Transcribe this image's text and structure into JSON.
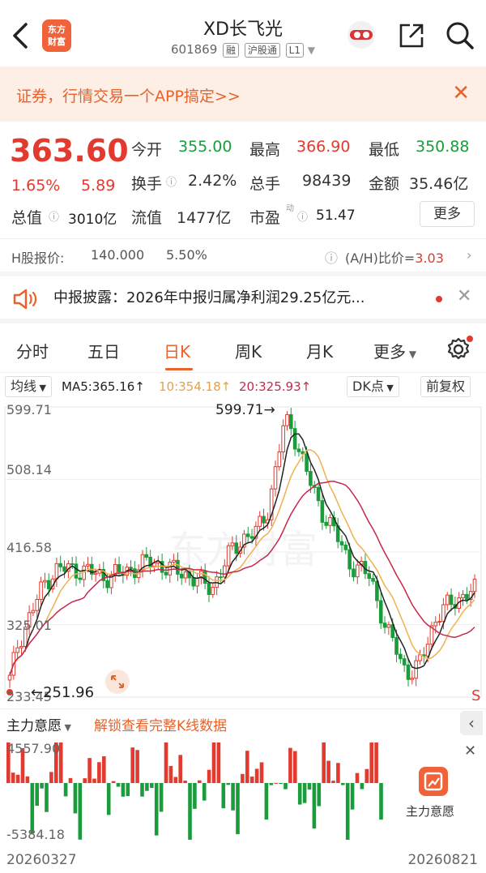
{
  "header": {
    "logo_text_line1": "东方",
    "logo_text_line2": "财富",
    "title": "XD长飞光",
    "code": "601869",
    "tags": [
      "融",
      "沪股通",
      "L1"
    ]
  },
  "banner": {
    "text": "证券，行情交易一个APP搞定>>"
  },
  "quote": {
    "price": "363.60",
    "change_pct": "1.65%",
    "change_amt": "5.89",
    "open_label": "今开",
    "open_value": "355.00",
    "high_label": "最高",
    "high_value": "366.90",
    "low_label": "最低",
    "low_value": "350.88",
    "turnover_label": "换手",
    "turnover_value": "2.42%",
    "volume_label": "总手",
    "volume_value": "98439",
    "amount_label": "金额",
    "amount_value": "35.46亿",
    "mktcap_label": "总值",
    "mktcap_value": "3010亿",
    "float_label": "流值",
    "float_value": "1477亿",
    "pe_label": "市盈",
    "pe_sup": "动",
    "pe_value": "51.47",
    "more_label": "更多"
  },
  "hshare": {
    "label": "H股报价:",
    "price": "140.000",
    "pct": "5.50%",
    "ratio_label": "(A/H)比价=",
    "ratio_value": "3.03"
  },
  "notice": {
    "text": "中报披露：2026年中报归属净利润29.25亿元..."
  },
  "tabs": [
    "分时",
    "五日",
    "日K",
    "周K",
    "月K",
    "更多"
  ],
  "active_tab": "日K",
  "ma_row": {
    "type_label": "均线",
    "ma5": "MA5:365.16↑",
    "ma10": "10:354.18↑",
    "ma20": "20:325.93↑",
    "dk_label": "DK点",
    "adj_label": "前复权"
  },
  "chart_data": {
    "type": "candlestick",
    "y_ticks": [
      "599.71",
      "508.14",
      "416.58",
      "325.01",
      "233.45"
    ],
    "ylim": [
      233.45,
      599.71
    ],
    "high_annotation": "599.71",
    "low_annotation": "251.96",
    "s_marker": "S",
    "watermark": "东方财富",
    "colors": {
      "up": "#e23a2e",
      "down": "#1a9c3c",
      "ma5": "#222222",
      "ma10": "#f0b050",
      "ma20": "#c8284a"
    }
  },
  "indicator": {
    "name": "主力意愿",
    "promo": "解锁查看完整K线数据",
    "top_value": "4557.90",
    "bottom_value": "-5384.18",
    "panel_label": "主力意愿"
  },
  "dates": {
    "start": "20260327",
    "end": "20260821"
  }
}
